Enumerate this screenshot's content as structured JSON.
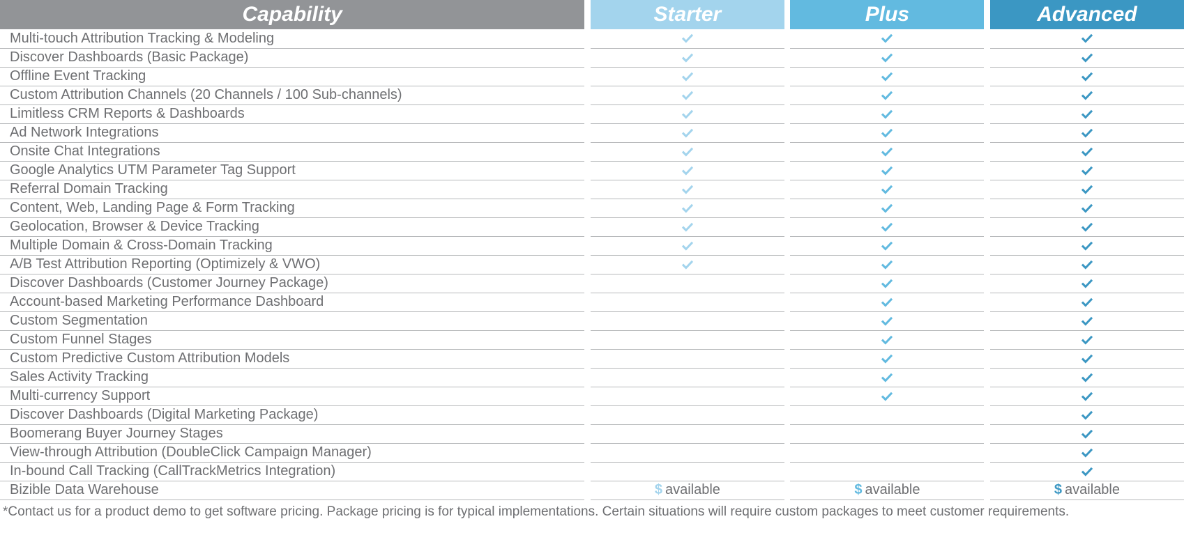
{
  "headers": {
    "capability": "Capability",
    "plans": [
      "Starter",
      "Plus",
      "Advanced"
    ]
  },
  "available_label": "available",
  "rows": [
    {
      "label": "Multi-touch Attribution Tracking & Modeling",
      "cells": [
        "check",
        "check",
        "check"
      ]
    },
    {
      "label": "Discover Dashboards (Basic Package)",
      "cells": [
        "check",
        "check",
        "check"
      ]
    },
    {
      "label": "Offline Event Tracking",
      "cells": [
        "check",
        "check",
        "check"
      ]
    },
    {
      "label": "Custom Attribution Channels (20 Channels / 100 Sub-channels)",
      "cells": [
        "check",
        "check",
        "check"
      ]
    },
    {
      "label": "Limitless CRM Reports & Dashboards",
      "cells": [
        "check",
        "check",
        "check"
      ]
    },
    {
      "label": "Ad Network Integrations",
      "cells": [
        "check",
        "check",
        "check"
      ]
    },
    {
      "label": "Onsite Chat Integrations",
      "cells": [
        "check",
        "check",
        "check"
      ]
    },
    {
      "label": "Google Analytics UTM Parameter Tag Support",
      "cells": [
        "check",
        "check",
        "check"
      ]
    },
    {
      "label": "Referral Domain Tracking",
      "cells": [
        "check",
        "check",
        "check"
      ]
    },
    {
      "label": "Content, Web, Landing Page & Form Tracking",
      "cells": [
        "check",
        "check",
        "check"
      ]
    },
    {
      "label": "Geolocation, Browser & Device Tracking",
      "cells": [
        "check",
        "check",
        "check"
      ]
    },
    {
      "label": "Multiple Domain & Cross-Domain Tracking",
      "cells": [
        "check",
        "check",
        "check"
      ]
    },
    {
      "label": "A/B Test Attribution Reporting (Optimizely & VWO)",
      "cells": [
        "check",
        "check",
        "check"
      ]
    },
    {
      "label": "Discover Dashboards (Customer Journey Package)",
      "cells": [
        "",
        "check",
        "check"
      ]
    },
    {
      "label": "Account-based Marketing Performance Dashboard",
      "cells": [
        "",
        "check",
        "check"
      ]
    },
    {
      "label": "Custom Segmentation",
      "cells": [
        "",
        "check",
        "check"
      ]
    },
    {
      "label": "Custom Funnel Stages",
      "cells": [
        "",
        "check",
        "check"
      ]
    },
    {
      "label": "Custom Predictive Custom Attribution Models",
      "cells": [
        "",
        "check",
        "check"
      ]
    },
    {
      "label": "Sales Activity Tracking",
      "cells": [
        "",
        "check",
        "check"
      ]
    },
    {
      "label": "Multi-currency Support",
      "cells": [
        "",
        "check",
        "check"
      ]
    },
    {
      "label": "Discover Dashboards (Digital Marketing Package)",
      "cells": [
        "",
        "",
        "check"
      ]
    },
    {
      "label": "Boomerang Buyer Journey Stages",
      "cells": [
        "",
        "",
        "check"
      ]
    },
    {
      "label": "View-through Attribution (DoubleClick Campaign Manager)",
      "cells": [
        "",
        "",
        "check"
      ]
    },
    {
      "label": "In-bound Call Tracking (CallTrackMetrics Integration)",
      "cells": [
        "",
        "",
        "check"
      ]
    },
    {
      "label": "Bizible Data Warehouse",
      "cells": [
        "dollar",
        "dollar",
        "dollar"
      ]
    }
  ],
  "footnote": "*Contact us for a product demo to get software pricing. Package pricing is for typical implementations. Certain situations will require custom packages to meet customer requirements."
}
